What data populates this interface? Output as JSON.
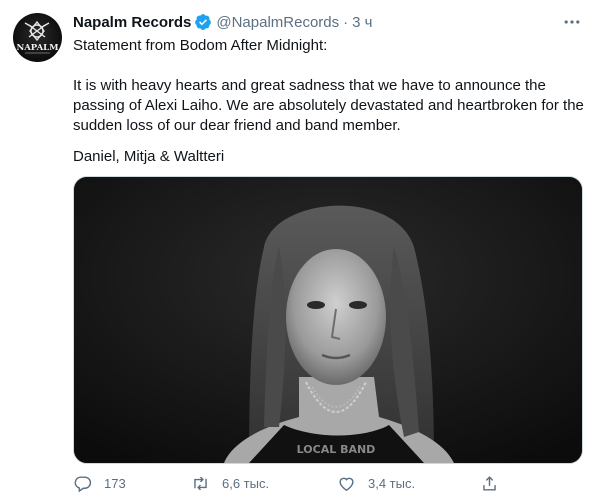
{
  "tweet": {
    "display_name": "Napalm Records",
    "handle": "@NapalmRecords",
    "separator": "·",
    "time": "3 ч",
    "text_lines": [
      "Statement from Bodom After Midnight:",
      "It is with heavy hearts and great sadness that we have to announce the",
      "passing of Alexi Laiho. We are absolutely devastated and heartbroken for the",
      "sudden loss of our dear friend and band member.",
      "Daniel, Mitja & Waltteri"
    ],
    "avatar_logo_text": "NAPALM",
    "verified_icon": "verified-badge-icon",
    "more_icon": "more-icon",
    "photo_shirt_text": "LOCAL BAND"
  },
  "actions": {
    "reply": {
      "icon": "reply-icon",
      "count": "173"
    },
    "retweet": {
      "icon": "retweet-icon",
      "count": "6,6 тыс."
    },
    "like": {
      "icon": "heart-icon",
      "count": "3,4 тыс."
    },
    "share": {
      "icon": "share-icon"
    }
  },
  "colors": {
    "text": "#0f1419",
    "secondary": "#5b7083",
    "verified": "#1da1f2",
    "border": "#cfd9de"
  }
}
